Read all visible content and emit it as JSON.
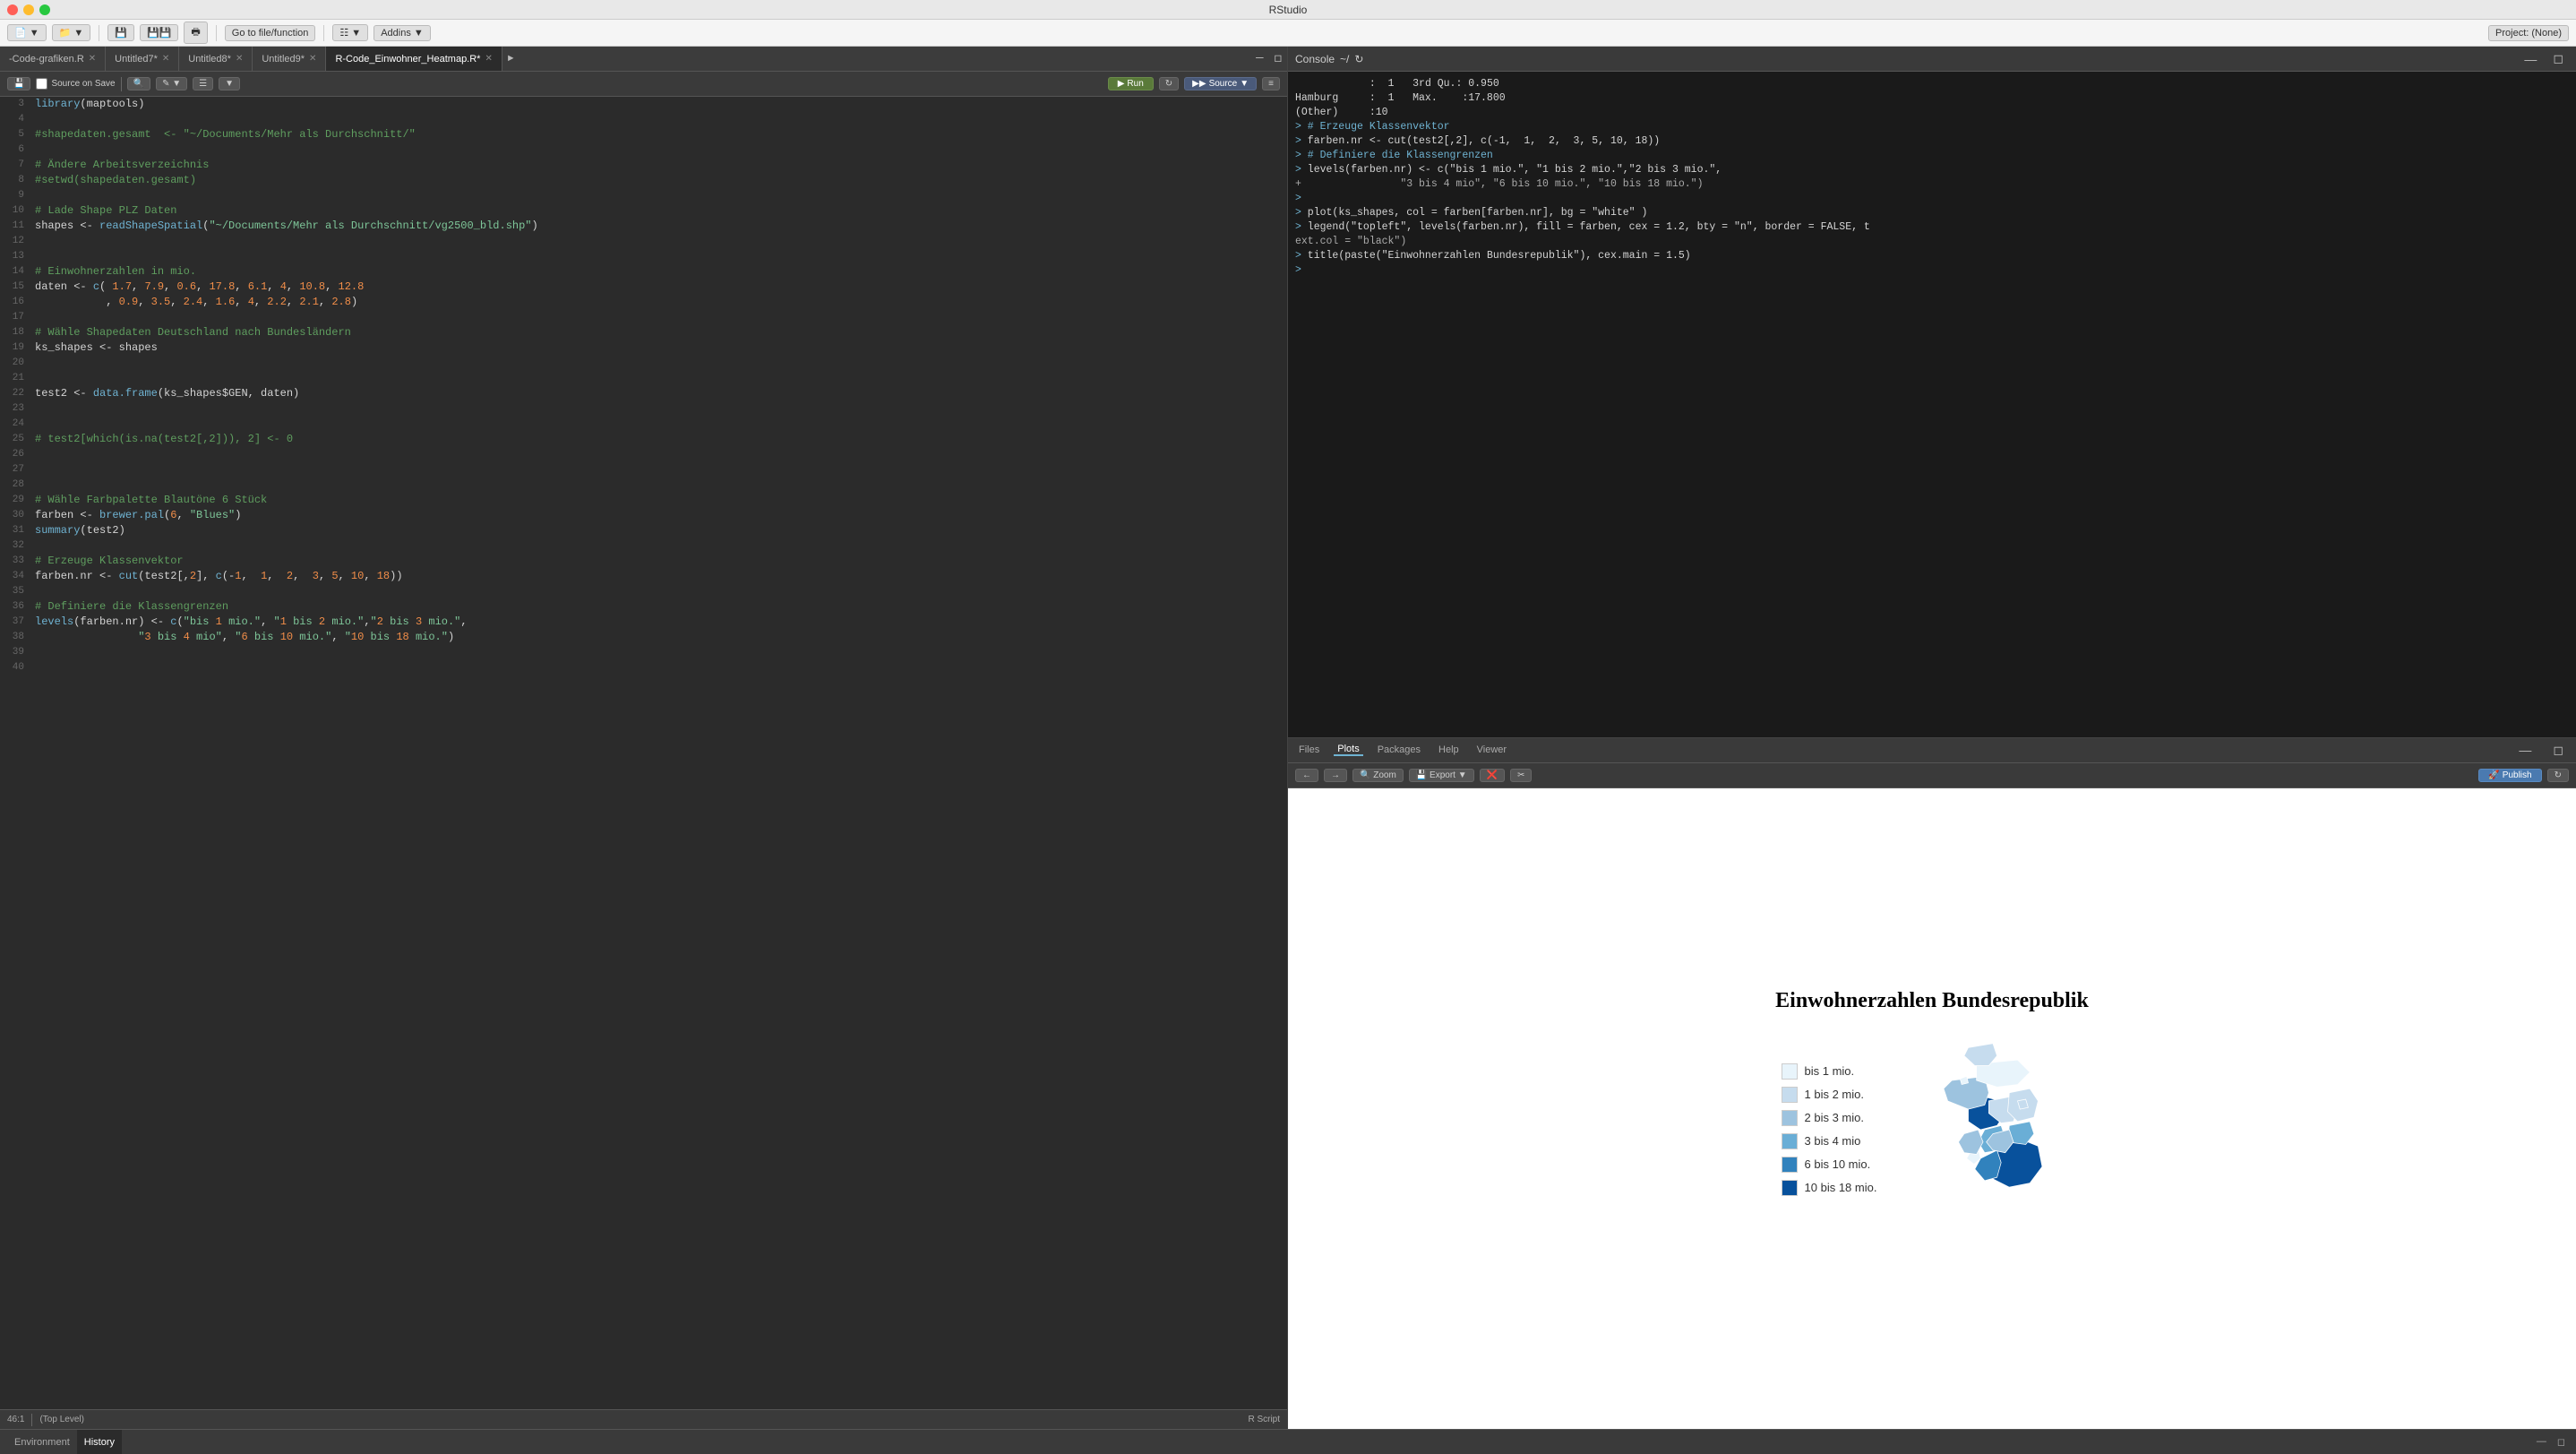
{
  "app": {
    "title": "RStudio"
  },
  "toolbar": {
    "go_to_file": "Go to file/function",
    "addins": "Addins",
    "project": "Project: (None)"
  },
  "tabs": [
    {
      "id": "code-grafiken",
      "label": "-Code-grafiken.R",
      "active": false,
      "modified": false
    },
    {
      "id": "untitled7",
      "label": "Untitled7*",
      "active": false,
      "modified": true
    },
    {
      "id": "untitled8",
      "label": "Untitled8*",
      "active": false,
      "modified": true
    },
    {
      "id": "untitled9",
      "label": "Untitled9*",
      "active": false,
      "modified": true
    },
    {
      "id": "r-code-einwohner",
      "label": "R-Code_Einwohner_Heatmap.R*",
      "active": true,
      "modified": true
    }
  ],
  "editor_toolbar": {
    "source_on_save": "Source on Save",
    "run": "Run",
    "source": "Source"
  },
  "code_lines": [
    {
      "num": 3,
      "content": "library(maptools)",
      "type": "code"
    },
    {
      "num": 4,
      "content": "",
      "type": "blank"
    },
    {
      "num": 5,
      "content": "#shapedaten.gesamt  <- \"~/Documents/Mehr als Durchschnitt/\"",
      "type": "comment"
    },
    {
      "num": 6,
      "content": "",
      "type": "blank"
    },
    {
      "num": 7,
      "content": "# Ändere Arbeitsverzeichnis",
      "type": "comment"
    },
    {
      "num": 8,
      "content": "#setwd(shapedaten.gesamt)",
      "type": "comment"
    },
    {
      "num": 9,
      "content": "",
      "type": "blank"
    },
    {
      "num": 10,
      "content": "# Lade Shape PLZ Daten",
      "type": "comment"
    },
    {
      "num": 11,
      "content": "shapes <- readShapeSpatial(\"~/Documents/Mehr als Durchschnitt/vg2500_bld.shp\")",
      "type": "code"
    },
    {
      "num": 12,
      "content": "",
      "type": "blank"
    },
    {
      "num": 13,
      "content": "",
      "type": "blank"
    },
    {
      "num": 14,
      "content": "# Einwohnerzahlen in mio.",
      "type": "comment"
    },
    {
      "num": 15,
      "content": "daten <- c( 1.7, 7.9, 0.6, 17.8, 6.1, 4, 10.8, 12.8",
      "type": "code"
    },
    {
      "num": 16,
      "content": "           , 0.9, 3.5, 2.4, 1.6, 4, 2.2, 2.1, 2.8)",
      "type": "code"
    },
    {
      "num": 17,
      "content": "",
      "type": "blank"
    },
    {
      "num": 18,
      "content": "# Wähle Shapedaten Deutschland nach Bundesländern",
      "type": "comment"
    },
    {
      "num": 19,
      "content": "ks_shapes <- shapes",
      "type": "code"
    },
    {
      "num": 20,
      "content": "",
      "type": "blank"
    },
    {
      "num": 21,
      "content": "",
      "type": "blank"
    },
    {
      "num": 22,
      "content": "test2 <- data.frame(ks_shapes$GEN, daten)",
      "type": "code"
    },
    {
      "num": 23,
      "content": "",
      "type": "blank"
    },
    {
      "num": 24,
      "content": "",
      "type": "blank"
    },
    {
      "num": 25,
      "content": "# test2[which(is.na(test2[,2])), 2] <- 0",
      "type": "comment"
    },
    {
      "num": 26,
      "content": "",
      "type": "blank"
    },
    {
      "num": 27,
      "content": "",
      "type": "blank"
    },
    {
      "num": 28,
      "content": "",
      "type": "blank"
    },
    {
      "num": 29,
      "content": "# Wähle Farbpalette Blautöne 6 Stück",
      "type": "comment"
    },
    {
      "num": 30,
      "content": "farben <- brewer.pal(6, \"Blues\")",
      "type": "code"
    },
    {
      "num": 31,
      "content": "summary(test2)",
      "type": "code"
    },
    {
      "num": 32,
      "content": "",
      "type": "blank"
    },
    {
      "num": 33,
      "content": "# Erzeuge Klassenvektor",
      "type": "comment"
    },
    {
      "num": 34,
      "content": "farben.nr <- cut(test2[,2], c(-1,  1,  2,  3, 5, 10, 18))",
      "type": "code"
    },
    {
      "num": 35,
      "content": "",
      "type": "blank"
    },
    {
      "num": 36,
      "content": "# Definiere die Klassengrenzen",
      "type": "comment"
    },
    {
      "num": 37,
      "content": "levels(farben.nr) <- c(\"bis 1 mio.\", \"1 bis 2 mio.\",\"2 bis 3 mio.\",",
      "type": "code"
    },
    {
      "num": 38,
      "content": "                \"3 bis 4 mio\", \"6 bis 10 mio.\", \"10 bis 18 mio.\")",
      "type": "code"
    },
    {
      "num": 39,
      "content": "",
      "type": "blank"
    },
    {
      "num": 40,
      "content": "",
      "type": "blank"
    }
  ],
  "statusbar": {
    "position": "46:1",
    "scope": "(Top Level)",
    "filetype": "R Script"
  },
  "console": {
    "title": "Console",
    "working_dir": "~/",
    "lines": [
      {
        "type": "output",
        "text": "            :  1   3rd Qu.: 0.950"
      },
      {
        "type": "output",
        "text": "Hamburg     :  1   Max.    :17.800"
      },
      {
        "type": "output",
        "text": "(Other)     :10"
      },
      {
        "type": "blank",
        "text": ""
      },
      {
        "type": "prompt",
        "text": "> # Erzeuge Klassenvektor"
      },
      {
        "type": "prompt",
        "text": "> farben.nr <- cut(test2[,2], c(-1,  1,  2,  3, 5, 10, 18))"
      },
      {
        "type": "blank",
        "text": ""
      },
      {
        "type": "prompt",
        "text": "> # Definiere die Klassengrenzen"
      },
      {
        "type": "prompt",
        "text": "> levels(farben.nr) <- c(\"bis 1 mio.\", \"1 bis 2 mio.\",\"2 bis 3 mio.\","
      },
      {
        "type": "continuation",
        "text": "+                \"3 bis 4 mio\", \"6 bis 10 mio.\", \"10 bis 18 mio.\")"
      },
      {
        "type": "blank",
        "text": ""
      },
      {
        "type": "prompt",
        "text": ">"
      },
      {
        "type": "prompt",
        "text": "> plot(ks_shapes, col = farben[farben.nr], bg = \"white\" )"
      },
      {
        "type": "blank",
        "text": ""
      },
      {
        "type": "prompt",
        "text": "> legend(\"topleft\", levels(farben.nr), fill = farben, cex = 1.2, bty = \"n\", border = FALSE, t"
      },
      {
        "type": "continuation",
        "text": "ext.col = \"black\")"
      },
      {
        "type": "prompt",
        "text": "> title(paste(\"Einwohnerzahlen Bundesrepublik\"), cex.main = 1.5)"
      },
      {
        "type": "prompt_empty",
        "text": ">"
      }
    ]
  },
  "plots_panel": {
    "tabs": [
      "Files",
      "Plots",
      "Packages",
      "Help",
      "Viewer"
    ],
    "active_tab": "Plots",
    "toolbar_buttons": [
      "Zoom",
      "Export",
      "remove",
      "broom"
    ],
    "publish_label": "Publish",
    "plot": {
      "title": "Einwohnerzahlen Bundesrepublik",
      "legend": [
        {
          "label": "bis 1 mio.",
          "color": "#e8f4fb"
        },
        {
          "label": "1 bis 2 mio.",
          "color": "#c6dcee"
        },
        {
          "label": "2 bis 3 mio.",
          "color": "#9dc3df"
        },
        {
          "label": "3 bis 4 mio",
          "color": "#6aaed6"
        },
        {
          "label": "6 bis 10 mio.",
          "color": "#3182bd"
        },
        {
          "label": "10 bis 18 mio.",
          "color": "#08519c"
        }
      ]
    }
  },
  "bottom_panel": {
    "tabs": [
      "Environment",
      "History"
    ],
    "active_tab": "History"
  }
}
